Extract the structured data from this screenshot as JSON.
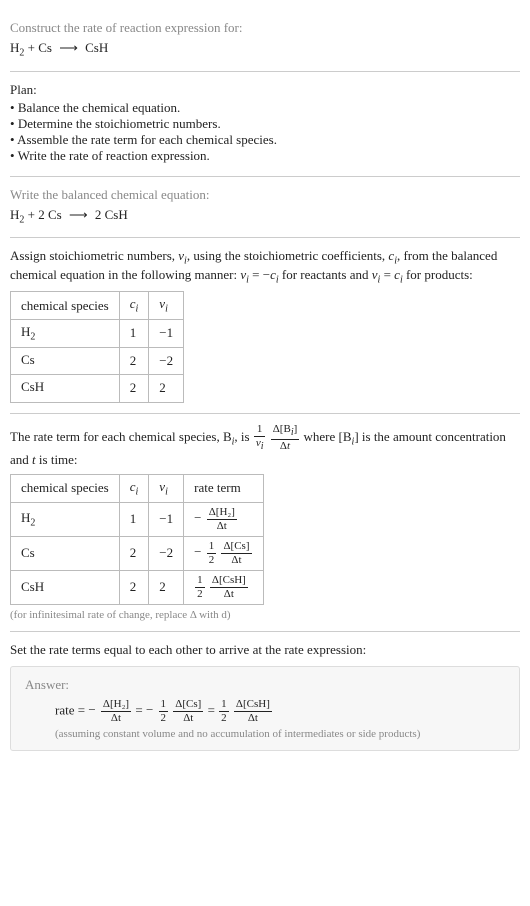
{
  "intro": {
    "prompt": "Construct the rate of reaction expression for:",
    "equation_lhs1": "H",
    "equation_lhs1_sub": "2",
    "equation_plus": " + Cs ",
    "equation_arrow": "⟶",
    "equation_rhs": " CsH"
  },
  "plan": {
    "label": "Plan:",
    "items": [
      "Balance the chemical equation.",
      "Determine the stoichiometric numbers.",
      "Assemble the rate term for each chemical species.",
      "Write the rate of reaction expression."
    ]
  },
  "balanced": {
    "prompt": "Write the balanced chemical equation:",
    "lhs1": "H",
    "lhs1_sub": "2",
    "plus": " + 2 Cs ",
    "arrow": "⟶",
    "rhs": " 2 CsH"
  },
  "assign": {
    "text1": "Assign stoichiometric numbers, ",
    "nu": "ν",
    "sub_i": "i",
    "text2": ", using the stoichiometric coefficients, ",
    "c": "c",
    "text3": ", from the balanced chemical equation in the following manner: ",
    "rel1a": "ν",
    "rel1b": " = −",
    "rel1c": "c",
    "text4": " for reactants and ",
    "rel2a": "ν",
    "rel2b": " = ",
    "rel2c": "c",
    "text5": " for products:",
    "table": {
      "h_species": "chemical species",
      "h_c": "c",
      "h_nu": "ν",
      "rows": [
        {
          "sp_a": "H",
          "sp_sub": "2",
          "c": "1",
          "nu": "−1"
        },
        {
          "sp_a": "Cs",
          "sp_sub": "",
          "c": "2",
          "nu": "−2"
        },
        {
          "sp_a": "CsH",
          "sp_sub": "",
          "c": "2",
          "nu": "2"
        }
      ]
    }
  },
  "rateterm": {
    "text1": "The rate term for each chemical species, B",
    "sub_i": "i",
    "text2": ", is ",
    "frac1_num": "1",
    "frac1_den_a": "ν",
    "frac2_num_a": "Δ[B",
    "frac2_num_b": "]",
    "frac2_den": "Δt",
    "text3": " where [B",
    "text4": "] is the amount concentration and ",
    "t": "t",
    "text5": " is time:",
    "table": {
      "h_species": "chemical species",
      "h_c": "c",
      "h_nu": "ν",
      "h_rate": "rate term",
      "rows": [
        {
          "sp_a": "H",
          "sp_sub": "2",
          "c": "1",
          "nu": "−1",
          "pre": "−",
          "coef_num": "",
          "coef_den": "",
          "num": "Δ[H₂]",
          "den": "Δt"
        },
        {
          "sp_a": "Cs",
          "sp_sub": "",
          "c": "2",
          "nu": "−2",
          "pre": "−",
          "coef_num": "1",
          "coef_den": "2",
          "num": "Δ[Cs]",
          "den": "Δt"
        },
        {
          "sp_a": "CsH",
          "sp_sub": "",
          "c": "2",
          "nu": "2",
          "pre": "",
          "coef_num": "1",
          "coef_den": "2",
          "num": "Δ[CsH]",
          "den": "Δt"
        }
      ]
    },
    "note": "(for infinitesimal rate of change, replace Δ with d)"
  },
  "final": {
    "prompt": "Set the rate terms equal to each other to arrive at the rate expression:",
    "answer_label": "Answer:",
    "rate": "rate = ",
    "t1_pre": "−",
    "t1_num": "Δ[H₂]",
    "t1_den": "Δt",
    "eq1": " = ",
    "t2_pre": "−",
    "t2_cnum": "1",
    "t2_cden": "2",
    "t2_num": "Δ[Cs]",
    "t2_den": "Δt",
    "eq2": " = ",
    "t3_cnum": "1",
    "t3_cden": "2",
    "t3_num": "Δ[CsH]",
    "t3_den": "Δt",
    "assume": "(assuming constant volume and no accumulation of intermediates or side products)"
  },
  "chart_data": {
    "type": "table",
    "tables": [
      {
        "name": "stoichiometric_numbers",
        "columns": [
          "chemical species",
          "c_i",
          "nu_i"
        ],
        "rows": [
          [
            "H2",
            1,
            -1
          ],
          [
            "Cs",
            2,
            -2
          ],
          [
            "CsH",
            2,
            2
          ]
        ]
      },
      {
        "name": "rate_terms",
        "columns": [
          "chemical species",
          "c_i",
          "nu_i",
          "rate term"
        ],
        "rows": [
          [
            "H2",
            1,
            -1,
            "-Δ[H2]/Δt"
          ],
          [
            "Cs",
            2,
            -2,
            "-(1/2) Δ[Cs]/Δt"
          ],
          [
            "CsH",
            2,
            2,
            "(1/2) Δ[CsH]/Δt"
          ]
        ]
      }
    ]
  }
}
